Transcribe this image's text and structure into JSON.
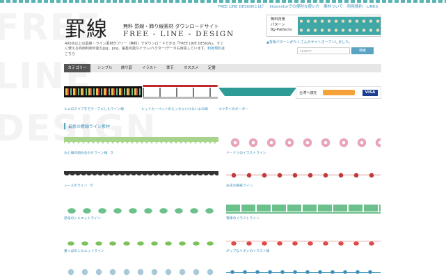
{
  "header": {
    "top_links": [
      "FREE LINE DESIGNとは？",
      "Illustratorでの便利な使い方",
      "素材ついて",
      "利用規約",
      "LINKS"
    ],
    "logo_kanji": "罫線",
    "logo_sub": "無料 罫線・飾り線素材 ダウンロードサイト",
    "logo_en": "FREE - LINE - DESIGN",
    "intro_text": "400点以上の罫線・ライン素材がフリー（無料）でダウンロードできる「FREE LINE DESIGN」。すぐに使える商用利用可能なjpg、png、編集可能なイラレ(ベクター)データも用意しています。",
    "intro_link": "利用規約",
    "intro_tail": "はこちら"
  },
  "banner": {
    "line1": "無料背景",
    "line2": "パターン",
    "line3": "Bg-Patterns",
    "notice": "▲背景パターンがたくさんのサイトオープンしました。"
  },
  "search": {
    "placeholder": "search",
    "button": "検索"
  },
  "nav": {
    "items": [
      "カテゴリー",
      "シンプル",
      "飾り罫",
      "イラスト",
      "季节",
      "オススメ",
      "定番"
    ]
  },
  "featured": [
    {
      "caption": "ヒエログリフをモチーフにしたライン線"
    },
    {
      "caption": "レッドカーペットのえっちゃいけないよの線"
    },
    {
      "caption": "ネクタイのボーダー"
    },
    {
      "caption": "台湾へ旅を",
      "sub": "visa"
    }
  ],
  "section_title": "最新の罫線ライン素材",
  "items": [
    {
      "caption": "丸と線の組み合わせライン線　3",
      "kind": "green-arch",
      "color": "#a6d48a"
    },
    {
      "caption": "ドーナツのイラストライン",
      "kind": "donut",
      "color": "#e8a6b8"
    },
    {
      "caption": "レースのライン　6",
      "kind": "lace",
      "color": "#333333"
    },
    {
      "caption": "お花の細枝ライン",
      "kind": "flower",
      "color": "#c23a3a"
    },
    {
      "caption": "恐竜のシルエットライン",
      "kind": "dino",
      "color": "#6cc08b"
    },
    {
      "caption": "電車のイラストライン",
      "kind": "train",
      "color": "#6cc08b"
    },
    {
      "caption": "葉っぱのシルエットライン",
      "kind": "leaf",
      "color": "#7cc15a"
    },
    {
      "caption": "ポップなリボンのイラスト線",
      "kind": "ribbon",
      "color": "#e04a4a"
    },
    {
      "caption": "",
      "kind": "skull",
      "color": "#a9c9d9"
    },
    {
      "caption": "",
      "kind": "anchor",
      "color": "#3d8fb8"
    }
  ]
}
